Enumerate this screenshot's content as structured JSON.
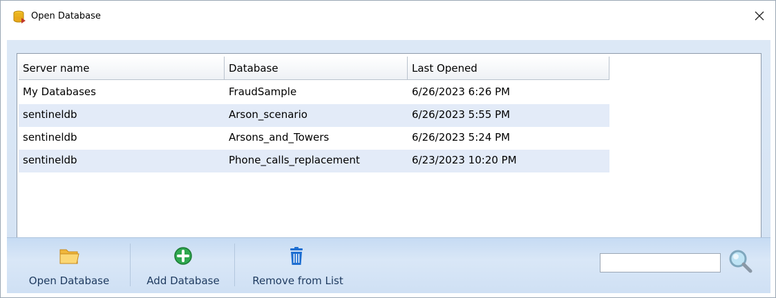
{
  "window": {
    "title": "Open Database",
    "close_glyph": "✕"
  },
  "grid": {
    "columns": [
      "Server name",
      "Database",
      "Last Opened"
    ],
    "rows": [
      {
        "server": "My Databases",
        "database": "FraudSample",
        "last_opened": "6/26/2023 6:26 PM"
      },
      {
        "server": "sentineldb",
        "database": "Arson_scenario",
        "last_opened": "6/26/2023 5:55 PM"
      },
      {
        "server": "sentineldb",
        "database": "Arsons_and_Towers",
        "last_opened": "6/26/2023 5:24 PM"
      },
      {
        "server": "sentineldb",
        "database": "Phone_calls_replacement",
        "last_opened": "6/23/2023 10:20 PM"
      }
    ]
  },
  "toolbar": {
    "open_label": "Open Database",
    "add_label": "Add Database",
    "remove_label": "Remove from List",
    "search_value": "",
    "search_placeholder": ""
  },
  "icons": {
    "app": "database-stack-icon",
    "open": "folder-icon",
    "add": "plus-circle-icon",
    "remove": "trash-icon",
    "search": "magnifier-icon",
    "close": "close-icon"
  },
  "colors": {
    "row_alt": "#e3ebf8",
    "toolbar_bg": "#d9e7f7",
    "label_text": "#1e3a5f",
    "add_green": "#2fa84f",
    "trash_blue": "#1f6fd1",
    "folder_orange": "#f5c04a"
  }
}
